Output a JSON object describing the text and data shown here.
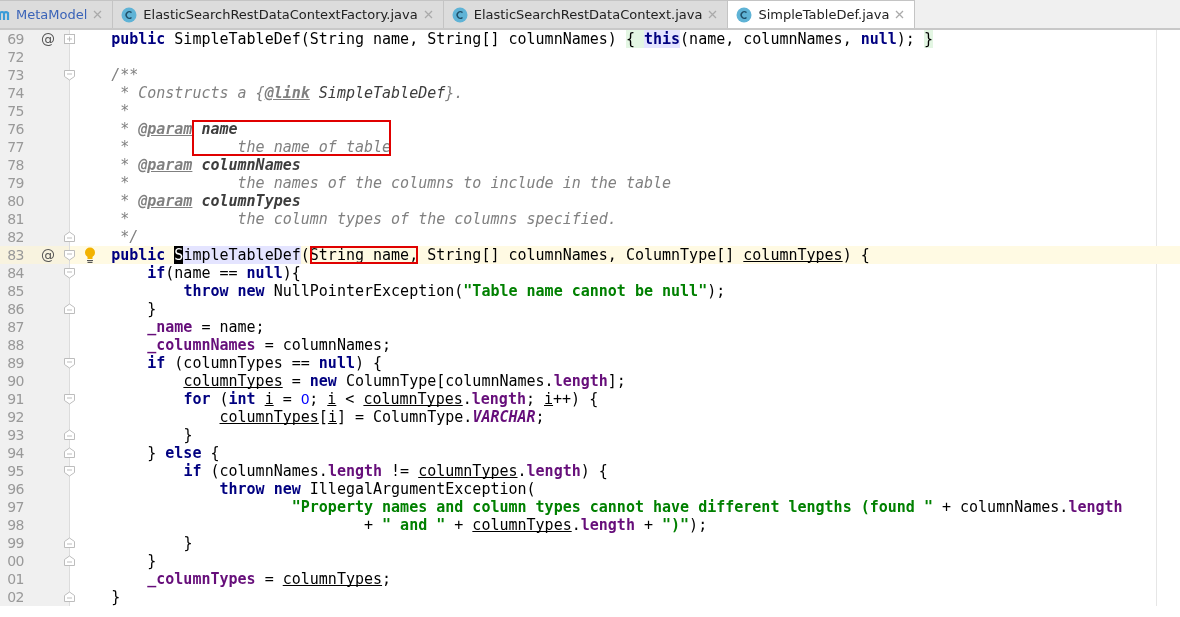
{
  "tabs": [
    {
      "label": "MetaModel",
      "kind": "module",
      "selected": false
    },
    {
      "label": "ElasticSearchRestDataContextFactory.java",
      "kind": "class",
      "selected": false
    },
    {
      "label": "ElasticSearchRestDataContext.java",
      "kind": "class",
      "selected": false
    },
    {
      "label": "SimpleTableDef.java",
      "kind": "class",
      "selected": true
    }
  ],
  "editor": {
    "lines": [
      {
        "number": "69",
        "marker": "@",
        "collapsed": true,
        "segments": [
          {
            "text": "    public",
            "kind": "kw"
          },
          {
            "text": " SimpleTableDef(String name, String[] columnNames) "
          },
          {
            "text": "{ ",
            "matched_brace": true
          },
          {
            "text": "this",
            "kind": "kw",
            "usage": true
          },
          {
            "text": "(name, columnNames, "
          },
          {
            "text": "null",
            "kind": "kw"
          },
          {
            "text": "); "
          },
          {
            "text": "}",
            "matched_brace": true
          }
        ]
      },
      {
        "number": "72"
      },
      {
        "number": "73",
        "fold_start": true,
        "segments": [
          {
            "text": "    /**",
            "kind": "doc"
          }
        ]
      },
      {
        "number": "74",
        "segments": [
          {
            "text": "     * Constructs a {",
            "kind": "doc"
          },
          {
            "text": "@link",
            "kind": "doctag"
          },
          {
            "text": " SimpleTableDef",
            "kind": "docref"
          },
          {
            "text": "}.",
            "kind": "doc"
          }
        ]
      },
      {
        "number": "75",
        "segments": [
          {
            "text": "     *",
            "kind": "doc"
          }
        ]
      },
      {
        "number": "76",
        "segments": [
          {
            "text": "     * ",
            "kind": "doc"
          },
          {
            "text": "@param",
            "kind": "doctag"
          },
          {
            "text": " name",
            "kind": "docparam",
            "boxed": true
          }
        ]
      },
      {
        "number": "77",
        "segments": [
          {
            "text": "     *       ",
            "kind": "doc"
          },
          {
            "text": "     the name of table",
            "kind": "doc",
            "boxed": true
          }
        ]
      },
      {
        "number": "78",
        "segments": [
          {
            "text": "     * ",
            "kind": "doc"
          },
          {
            "text": "@param",
            "kind": "doctag"
          },
          {
            "text": " columnNames",
            "kind": "docparam"
          }
        ]
      },
      {
        "number": "79",
        "segments": [
          {
            "text": "     *            the names of the columns to include in the table",
            "kind": "doc"
          }
        ]
      },
      {
        "number": "80",
        "segments": [
          {
            "text": "     * ",
            "kind": "doc"
          },
          {
            "text": "@param",
            "kind": "doctag"
          },
          {
            "text": " columnTypes",
            "kind": "docparam"
          }
        ]
      },
      {
        "number": "81",
        "segments": [
          {
            "text": "     *            the column types of the columns specified.",
            "kind": "doc"
          }
        ]
      },
      {
        "number": "82",
        "fold_end": true,
        "segments": [
          {
            "text": "     */",
            "kind": "doc"
          }
        ]
      },
      {
        "number": "83",
        "marker": "@",
        "fold_start": true,
        "bulb": true,
        "current": true,
        "segments": [
          {
            "text": "    public ",
            "kind": "kw"
          },
          {
            "text": "S",
            "caret": true,
            "usage": true
          },
          {
            "text": "impleTableDef",
            "usage": true
          },
          {
            "text": "("
          },
          {
            "text": "String name,",
            "boxed": true
          },
          {
            "text": " String[] columnNames, ColumnType[] "
          },
          {
            "text": "columnTypes",
            "kind": "var"
          },
          {
            "text": ") {"
          }
        ]
      },
      {
        "number": "84",
        "fold_start": true,
        "segments": [
          {
            "text": "        if",
            "kind": "kw"
          },
          {
            "text": "(name == "
          },
          {
            "text": "null",
            "kind": "kw"
          },
          {
            "text": "){"
          }
        ]
      },
      {
        "number": "85",
        "segments": [
          {
            "text": "            throw new",
            "kind": "kw"
          },
          {
            "text": " NullPointerException("
          },
          {
            "text": "\"Table name cannot be null\"",
            "kind": "str"
          },
          {
            "text": ");"
          }
        ]
      },
      {
        "number": "86",
        "fold_end": true,
        "segments": [
          {
            "text": "        }"
          }
        ]
      },
      {
        "number": "87",
        "segments": [
          {
            "text": "        _name",
            "kind": "field"
          },
          {
            "text": " = name;"
          }
        ]
      },
      {
        "number": "88",
        "segments": [
          {
            "text": "        _columnNames",
            "kind": "field"
          },
          {
            "text": " = columnNames;"
          }
        ]
      },
      {
        "number": "89",
        "fold_start": true,
        "segments": [
          {
            "text": "        if",
            "kind": "kw"
          },
          {
            "text": " (columnTypes == "
          },
          {
            "text": "null",
            "kind": "kw"
          },
          {
            "text": ") {"
          }
        ]
      },
      {
        "number": "90",
        "segments": [
          {
            "text": "            columnTypes",
            "kind": "var"
          },
          {
            "text": " = "
          },
          {
            "text": "new",
            "kind": "kw"
          },
          {
            "text": " ColumnType[columnNames."
          },
          {
            "text": "length",
            "kind": "field"
          },
          {
            "text": "];"
          }
        ]
      },
      {
        "number": "91",
        "fold_start": true,
        "segments": [
          {
            "text": "            for",
            "kind": "kw"
          },
          {
            "text": " ("
          },
          {
            "text": "int",
            "kind": "kw"
          },
          {
            "text": " i",
            "kind": "var"
          },
          {
            "text": " = "
          },
          {
            "text": "0",
            "kind": "num"
          },
          {
            "text": "; "
          },
          {
            "text": "i",
            "kind": "var"
          },
          {
            "text": " < "
          },
          {
            "text": "columnTypes",
            "kind": "var"
          },
          {
            "text": "."
          },
          {
            "text": "length",
            "kind": "field"
          },
          {
            "text": "; "
          },
          {
            "text": "i",
            "kind": "var"
          },
          {
            "text": "++) {"
          }
        ]
      },
      {
        "number": "92",
        "segments": [
          {
            "text": "                columnTypes",
            "kind": "var"
          },
          {
            "text": "["
          },
          {
            "text": "i",
            "kind": "var"
          },
          {
            "text": "] = ColumnType."
          },
          {
            "text": "VARCHAR",
            "kind": "static"
          },
          {
            "text": ";"
          }
        ]
      },
      {
        "number": "93",
        "fold_end": true,
        "segments": [
          {
            "text": "            }"
          }
        ]
      },
      {
        "number": "94",
        "fold_end": true,
        "segments": [
          {
            "text": "        } "
          },
          {
            "text": "else",
            "kind": "kw"
          },
          {
            "text": " {"
          }
        ]
      },
      {
        "number": "95",
        "fold_start": true,
        "segments": [
          {
            "text": "            if",
            "kind": "kw"
          },
          {
            "text": " (columnNames."
          },
          {
            "text": "length",
            "kind": "field"
          },
          {
            "text": " != "
          },
          {
            "text": "columnTypes",
            "kind": "var"
          },
          {
            "text": "."
          },
          {
            "text": "length",
            "kind": "field"
          },
          {
            "text": ") {"
          }
        ]
      },
      {
        "number": "96",
        "segments": [
          {
            "text": "                throw new",
            "kind": "kw"
          },
          {
            "text": " IllegalArgumentException("
          }
        ]
      },
      {
        "number": "97",
        "segments": [
          {
            "text": "                        \"Property names and column types cannot have different lengths (found \"",
            "kind": "str"
          },
          {
            "text": " + columnNames."
          },
          {
            "text": "length",
            "kind": "field"
          }
        ]
      },
      {
        "number": "98",
        "segments": [
          {
            "text": "                                + "
          },
          {
            "text": "\" and \"",
            "kind": "str"
          },
          {
            "text": " + "
          },
          {
            "text": "columnTypes",
            "kind": "var"
          },
          {
            "text": "."
          },
          {
            "text": "length",
            "kind": "field"
          },
          {
            "text": " + "
          },
          {
            "text": "\")\"",
            "kind": "str"
          },
          {
            "text": ");"
          }
        ]
      },
      {
        "number": "99",
        "fold_end": true,
        "segments": [
          {
            "text": "            }"
          }
        ]
      },
      {
        "number": "00",
        "fold_end": true,
        "segments": [
          {
            "text": "        }"
          }
        ]
      },
      {
        "number": "01",
        "segments": [
          {
            "text": "        _columnTypes",
            "kind": "field"
          },
          {
            "text": " = "
          },
          {
            "text": "columnTypes",
            "kind": "var"
          },
          {
            "text": ";"
          }
        ]
      },
      {
        "number": "02",
        "fold_end": true,
        "segments": [
          {
            "text": "    }"
          }
        ]
      }
    ]
  }
}
